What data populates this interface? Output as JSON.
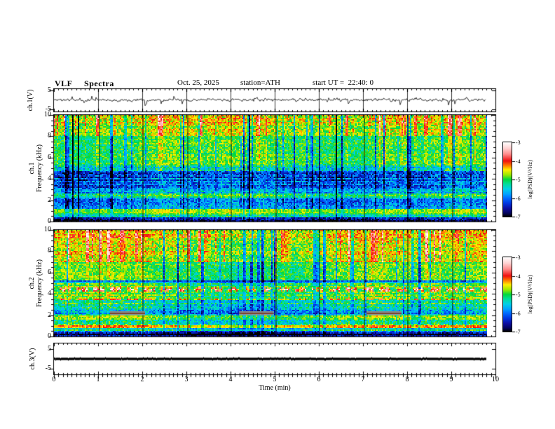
{
  "header": {
    "title": "VLF  Spectra",
    "date": "Oct. 25, 2025",
    "station": "station=ATH",
    "start_ut": "start UT =  22:40: 0"
  },
  "x_axis": {
    "label": "Time  (min)",
    "tick_labels": [
      "0",
      "1",
      "2",
      "3",
      "4",
      "5",
      "6",
      "7",
      "8",
      "9",
      "10"
    ],
    "min": 0,
    "max": 10,
    "minor_step": 0.1,
    "data_end": 9.8
  },
  "colorbar": {
    "label": "log(PSD)(V²/Hz)",
    "tick_labels": [
      "-3",
      "-4",
      "-5",
      "-6",
      "-7"
    ],
    "tick_values": [
      -3,
      -4,
      -5,
      -6,
      -7
    ],
    "gradient_stops": [
      [
        0.0,
        "#ffffff"
      ],
      [
        0.08,
        "#ffd2d2"
      ],
      [
        0.16,
        "#ff8c8c"
      ],
      [
        0.25,
        "#f01010"
      ],
      [
        0.31,
        "#ff7700"
      ],
      [
        0.37,
        "#ffee00"
      ],
      [
        0.44,
        "#97e800"
      ],
      [
        0.5,
        "#00d83c"
      ],
      [
        0.56,
        "#00dd99"
      ],
      [
        0.63,
        "#00cfe8"
      ],
      [
        0.7,
        "#009fff"
      ],
      [
        0.75,
        "#006cff"
      ],
      [
        0.82,
        "#0036e0"
      ],
      [
        0.89,
        "#0d0da0"
      ],
      [
        0.95,
        "#050560"
      ],
      [
        1.0,
        "#000000"
      ]
    ]
  },
  "chart_data": [
    {
      "type": "line",
      "channel": "ch.1",
      "ylabel": "ch.1(V)",
      "yticks": [
        5,
        -5
      ],
      "ytick_labels": [
        "5",
        "-5"
      ],
      "ylim": [
        5.6,
        -6.0
      ],
      "x_range": [
        0,
        9.8
      ],
      "signal": "broadband noisy voltage trace, mean near 0 V, ~±2 V fluctuations with impulsive spikes reaching ±5 V",
      "seed": 11,
      "noise_amp": 0.8,
      "neg_spike_prob": 0.015,
      "pos_spike_prob": 0.01
    },
    {
      "type": "heatmap",
      "channel": "ch.1",
      "ylabel_channel": "ch.1",
      "ylabel_axis": "Frequency (kHz)",
      "yticks": [
        10,
        8,
        6,
        4,
        2,
        0
      ],
      "ytick_labels": [
        "10",
        "8",
        "6",
        "4",
        "2",
        "0"
      ],
      "ylim": [
        0,
        10
      ],
      "x_range": [
        0,
        9.8
      ],
      "value_range": [
        -7,
        -3
      ],
      "units": "log(PSD)(V²/Hz)",
      "seed": 77,
      "bands": [
        {
          "f0": 10.0,
          "f1": 9.2,
          "v": -4.55,
          "n": 0.45,
          "hot": 1.1,
          "cold": 0.9,
          "str": 0.15
        },
        {
          "f0": 9.2,
          "f1": 8.0,
          "v": -4.75,
          "n": 0.4,
          "hot": 1.0,
          "cold": 0.9,
          "str": 0.15
        },
        {
          "f0": 8.0,
          "f1": 5.3,
          "v": -5.0,
          "n": 0.35,
          "hot": 0.35,
          "cold": 1.1,
          "str": 0.12
        },
        {
          "f0": 5.3,
          "f1": 4.7,
          "v": -5.5,
          "n": 0.55,
          "hot": 0.2,
          "cold": 0.9,
          "str": 0.3
        },
        {
          "f0": 4.7,
          "f1": 3.2,
          "v": -6.15,
          "n": 0.55,
          "hot": 0.1,
          "cold": 0.7,
          "str": 0.3
        },
        {
          "f0": 3.2,
          "f1": 2.65,
          "v": -5.8,
          "n": 0.5,
          "hot": 0.1,
          "cold": 0.6,
          "str": 0.3
        },
        {
          "f0": 2.65,
          "f1": 2.2,
          "v": -5.05,
          "n": 0.35,
          "hot": 0.15,
          "cold": 0.6,
          "str": 0.35
        },
        {
          "f0": 2.2,
          "f1": 1.2,
          "v": -5.95,
          "n": 0.5,
          "hot": 0.1,
          "cold": 0.6,
          "str": 0.35
        },
        {
          "f0": 1.2,
          "f1": 0.95,
          "v": -4.85,
          "n": 0.3,
          "hot": 0.1,
          "cold": 0.4,
          "str": 0.3
        },
        {
          "f0": 0.95,
          "f1": 0.6,
          "v": -4.8,
          "n": 0.25,
          "hot": 0.05,
          "cold": 0.3,
          "str": 0.6
        },
        {
          "f0": 0.6,
          "f1": 0.42,
          "v": -5.4,
          "n": 0.4,
          "hot": 0.05,
          "cold": 0.3,
          "str": 0.5
        },
        {
          "f0": 0.42,
          "f1": 0.18,
          "v": -6.5,
          "n": 0.45,
          "hot": 0.0,
          "cold": 0.3,
          "str": 0.4
        },
        {
          "f0": 0.18,
          "f1": 0.0,
          "v": -6.85,
          "n": 0.3,
          "hot": 0.0,
          "cold": 0.2,
          "str": 0.3
        }
      ]
    },
    {
      "type": "heatmap",
      "channel": "ch.2",
      "ylabel_channel": "ch.2",
      "ylabel_axis": "Frequency (kHz)",
      "yticks": [
        10,
        8,
        6,
        4,
        2,
        0
      ],
      "ytick_labels": [
        "10",
        "8",
        "6",
        "4",
        "2",
        "0"
      ],
      "ylim": [
        0,
        10
      ],
      "x_range": [
        0,
        9.8
      ],
      "value_range": [
        -7,
        -3
      ],
      "units": "log(PSD)(V²/Hz)",
      "seed": 1302,
      "bands": [
        {
          "f0": 10.0,
          "f1": 9.2,
          "v": -4.5,
          "n": 0.45,
          "hot": 1.1,
          "cold": 0.8,
          "str": 0.15
        },
        {
          "f0": 9.2,
          "f1": 7.0,
          "v": -4.68,
          "n": 0.4,
          "hot": 1.0,
          "cold": 0.9,
          "str": 0.15
        },
        {
          "f0": 7.0,
          "f1": 5.2,
          "v": -5.0,
          "n": 0.35,
          "hot": 0.3,
          "cold": 1.1,
          "str": 0.12
        },
        {
          "f0": 5.2,
          "f1": 5.0,
          "v": -5.9,
          "n": 0.4,
          "hot": 0.1,
          "cold": 0.5,
          "str": 0.3
        },
        {
          "f0": 5.0,
          "f1": 4.55,
          "v": -5.0,
          "n": 0.35,
          "hot": 0.2,
          "cold": 0.6,
          "str": 0.2
        },
        {
          "f0": 4.55,
          "f1": 4.25,
          "v": -4.25,
          "n": 1.0,
          "hot": 0.2,
          "cold": 1.0,
          "str": 0.5,
          "dash_bg": -5.1
        },
        {
          "f0": 4.25,
          "f1": 3.6,
          "v": -5.0,
          "n": 0.35,
          "hot": 0.2,
          "cold": 0.6,
          "str": 0.2
        },
        {
          "f0": 3.6,
          "f1": 3.38,
          "v": -4.0,
          "n": 0.5,
          "hot": 0.3,
          "cold": 0.8,
          "str": 0.4,
          "dash_bg": -5.1
        },
        {
          "f0": 3.38,
          "f1": 2.5,
          "v": -5.3,
          "n": 0.45,
          "hot": 0.15,
          "cold": 0.6,
          "str": 0.3
        },
        {
          "f0": 2.5,
          "f1": 2.0,
          "v": -5.65,
          "n": 0.5,
          "hot": 0.1,
          "cold": 0.5,
          "str": 0.35
        },
        {
          "f0": 2.0,
          "f1": 1.62,
          "v": -4.9,
          "n": 0.35,
          "hot": 0.1,
          "cold": 0.4,
          "str": 0.4
        },
        {
          "f0": 1.62,
          "f1": 1.05,
          "v": -5.35,
          "n": 0.45,
          "hot": 0.1,
          "cold": 0.5,
          "str": 0.35
        },
        {
          "f0": 1.05,
          "f1": 0.78,
          "v": -4.1,
          "n": 0.3,
          "hot": 0.2,
          "cold": 0.5,
          "str": 0.4
        },
        {
          "f0": 0.78,
          "f1": 0.55,
          "v": -5.2,
          "n": 0.4,
          "hot": 0.1,
          "cold": 0.4,
          "str": 0.5
        },
        {
          "f0": 0.55,
          "f1": 0.3,
          "v": -6.3,
          "n": 0.45,
          "hot": 0.0,
          "cold": 0.3,
          "str": 0.4
        },
        {
          "f0": 0.3,
          "f1": 0.0,
          "v": -6.8,
          "n": 0.35,
          "hot": 0.0,
          "cold": 0.2,
          "str": 0.3
        }
      ],
      "gray_patches": [
        {
          "t0": 1.27,
          "t1": 2.06,
          "f_low": 1.98,
          "f_high": 2.38
        },
        {
          "t0": 4.2,
          "t1": 4.97,
          "f_low": 1.98,
          "f_high": 2.38
        },
        {
          "t0": 7.08,
          "t1": 7.87,
          "f_low": 1.98,
          "f_high": 2.38
        }
      ]
    },
    {
      "type": "line",
      "channel": "ch.3",
      "ylabel": "ch.3(V)",
      "yticks": [
        5,
        -5
      ],
      "ytick_labels": [
        "5",
        "-5"
      ],
      "ylim": [
        7.9,
        -7.9
      ],
      "x_range": [
        0,
        9.8
      ],
      "signal": "constant flat trace at ≈ 0 V (thick saturated line)",
      "seed": 3
    }
  ]
}
